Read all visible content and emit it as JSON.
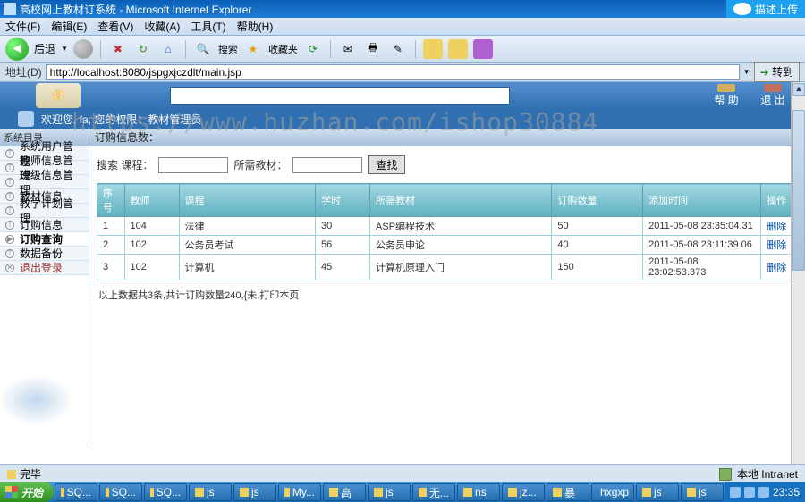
{
  "window": {
    "title": "高校网上教材订系统 - Microsoft Internet Explorer",
    "cloud_label": "描述上传"
  },
  "menubar": [
    "文件(F)",
    "编辑(E)",
    "查看(V)",
    "收藏(A)",
    "工具(T)",
    "帮助(H)"
  ],
  "toolbar": {
    "back": "后退"
  },
  "address": {
    "label": "地址(D)",
    "url": "http://localhost:8080/jspgxjczdlt/main.jsp",
    "go": "转到"
  },
  "header_icons": [
    "帮 助",
    "退 出"
  ],
  "welcome": "欢迎您, fa, 您的权限：教材管理员",
  "watermark": "https://www.huzhan.com/ishop30884",
  "sidebar": {
    "header": "系统目录",
    "items": [
      "系统用户管理",
      "教师信息管理",
      "班级信息管理",
      "教材信息",
      "教学计划管理",
      "订购信息",
      "订购查询",
      "数据备份",
      "退出登录"
    ],
    "active_index": 6
  },
  "crumb": "订购信息数：",
  "search": {
    "label1": "搜索 课程：",
    "label2": "所需教材：",
    "btn": "查找"
  },
  "table": {
    "headers": [
      "序号",
      "教师",
      "课程",
      "学时",
      "所需教材",
      "订购数量",
      "添加时间",
      "操作"
    ],
    "rows": [
      {
        "idx": "1",
        "teacher": "104",
        "course": "法律",
        "hours": "30",
        "book": "ASP编程技术",
        "qty": "50",
        "time": "2011-05-08 23:35:04.31",
        "op": "删除"
      },
      {
        "idx": "2",
        "teacher": "102",
        "course": "公务员考试",
        "hours": "56",
        "book": "公务员申论",
        "qty": "40",
        "time": "2011-05-08 23:11:39.06",
        "op": "删除"
      },
      {
        "idx": "3",
        "teacher": "102",
        "course": "计算机",
        "hours": "45",
        "book": "计算机原理入门",
        "qty": "150",
        "time": "2011-05-08 23:02:53.373",
        "op": "删除"
      }
    ]
  },
  "summary": "以上数据共3条,共计订购数量240,{未,打印本页",
  "statusbar": {
    "left": "完毕",
    "right": "本地 Intranet"
  },
  "taskbar": {
    "start": "开始",
    "items": [
      "SQ...",
      "SQ...",
      "SQ...",
      "js",
      "js",
      "My...",
      "高",
      "js",
      "无...",
      "ns",
      "jz...",
      "暴",
      "hxgxp",
      "js",
      "js"
    ],
    "clock": "23:35"
  }
}
